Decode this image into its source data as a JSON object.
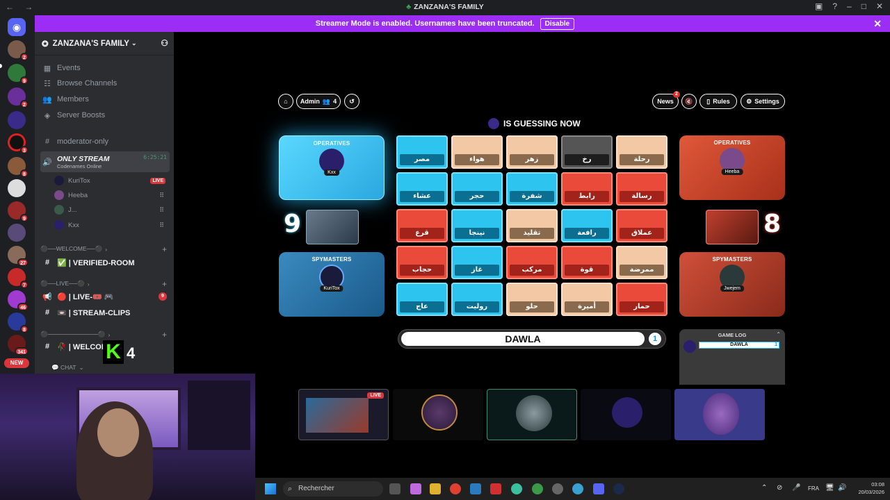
{
  "window": {
    "title": "ZANZANA'S FAMILY",
    "nav": "← →"
  },
  "banner": {
    "text": "Streamer Mode is enabled. Usernames have been truncated.",
    "button": "Disable"
  },
  "rail": {
    "badges": [
      "2",
      "9",
      "2",
      "",
      "3",
      "8",
      "",
      "",
      "9",
      "",
      "27",
      "7",
      "46",
      "8",
      "341"
    ],
    "new_label": "NEW"
  },
  "sidebar": {
    "server_name": "ZANZANA'S FAMILY",
    "top_items": [
      {
        "icon": "calendar-icon",
        "label": "Events"
      },
      {
        "icon": "browse-icon",
        "label": "Browse Channels"
      },
      {
        "icon": "members-icon",
        "label": "Members"
      },
      {
        "icon": "boost-icon",
        "label": "Server Boosts"
      }
    ],
    "channel_moderator": "moderator-only",
    "stream_channel": {
      "name": "ONLY STREAM",
      "sub": "Codenames Online",
      "time": "6:25:21"
    },
    "users": [
      {
        "name": "KuriTox",
        "live": "LIVE"
      },
      {
        "name": "Heeba"
      },
      {
        "name": "J..."
      },
      {
        "name": "Kxx"
      }
    ],
    "cat_welcome": "⚫──WELCOME──⚫",
    "verified_room": "✅ | VERIFIED-ROOM",
    "cat_live": "⚫──LIVE──⚫",
    "live_channel": "🔴 | LIVE-🎟️ 🎮",
    "live_badge": "9",
    "stream_clips": "📼 | STREAM-CLIPS",
    "cat_blank": "⚫────────────⚫",
    "welcome_channel": "🥀 | WELCOM",
    "cat_chat": "💬 CHAT",
    "overlay_number": "4"
  },
  "game": {
    "buttons": {
      "admin": "Admin",
      "admin_count": "4",
      "news": "News",
      "news_badge": "2",
      "rules": "Rules",
      "settings": "Settings"
    },
    "turn_text": "IS GUESSING NOW",
    "blue_team": {
      "operatives_label": "OPERATIVES",
      "operative": "Kxx",
      "spymasters_label": "SPYMASTERS",
      "spymaster": "KuriTox",
      "score": "9"
    },
    "red_team": {
      "operatives_label": "OPERATIVES",
      "operative": "Heeba",
      "spymasters_label": "SPYMASTERS",
      "spymaster": "Jwejem",
      "score": "8"
    },
    "cards": [
      {
        "word": "مصر",
        "color": "blue"
      },
      {
        "word": "هواء",
        "color": "neutral"
      },
      {
        "word": "زهر",
        "color": "neutral"
      },
      {
        "word": "رخ",
        "color": "black"
      },
      {
        "word": "رحلة",
        "color": "neutral"
      },
      {
        "word": "عشاء",
        "color": "blue"
      },
      {
        "word": "حجر",
        "color": "blue"
      },
      {
        "word": "شفرة",
        "color": "blue"
      },
      {
        "word": "رابط",
        "color": "red"
      },
      {
        "word": "رسالة",
        "color": "red"
      },
      {
        "word": "قرع",
        "color": "red"
      },
      {
        "word": "نينجا",
        "color": "blue"
      },
      {
        "word": "تقليد",
        "color": "neutral"
      },
      {
        "word": "رافعة",
        "color": "blue"
      },
      {
        "word": "عملاق",
        "color": "red"
      },
      {
        "word": "حجاب",
        "color": "red"
      },
      {
        "word": "غاز",
        "color": "blue"
      },
      {
        "word": "مركب",
        "color": "red"
      },
      {
        "word": "قوة",
        "color": "red"
      },
      {
        "word": "ممرضة",
        "color": "neutral"
      },
      {
        "word": "عاج",
        "color": "blue"
      },
      {
        "word": "روليت",
        "color": "blue"
      },
      {
        "word": "حلو",
        "color": "neutral"
      },
      {
        "word": "أميرة",
        "color": "neutral"
      },
      {
        "word": "حمار",
        "color": "red"
      }
    ],
    "clue": {
      "word": "DAWLA",
      "number": "1"
    },
    "game_log": {
      "title": "GAME LOG",
      "entry_word": "DAWLA",
      "entry_number": "1"
    }
  },
  "stream_strip": {
    "live": "LIVE"
  },
  "taskbar": {
    "search_placeholder": "Rechercher",
    "lang": "FRA",
    "time": "03:08",
    "date": "20/03/2026"
  }
}
